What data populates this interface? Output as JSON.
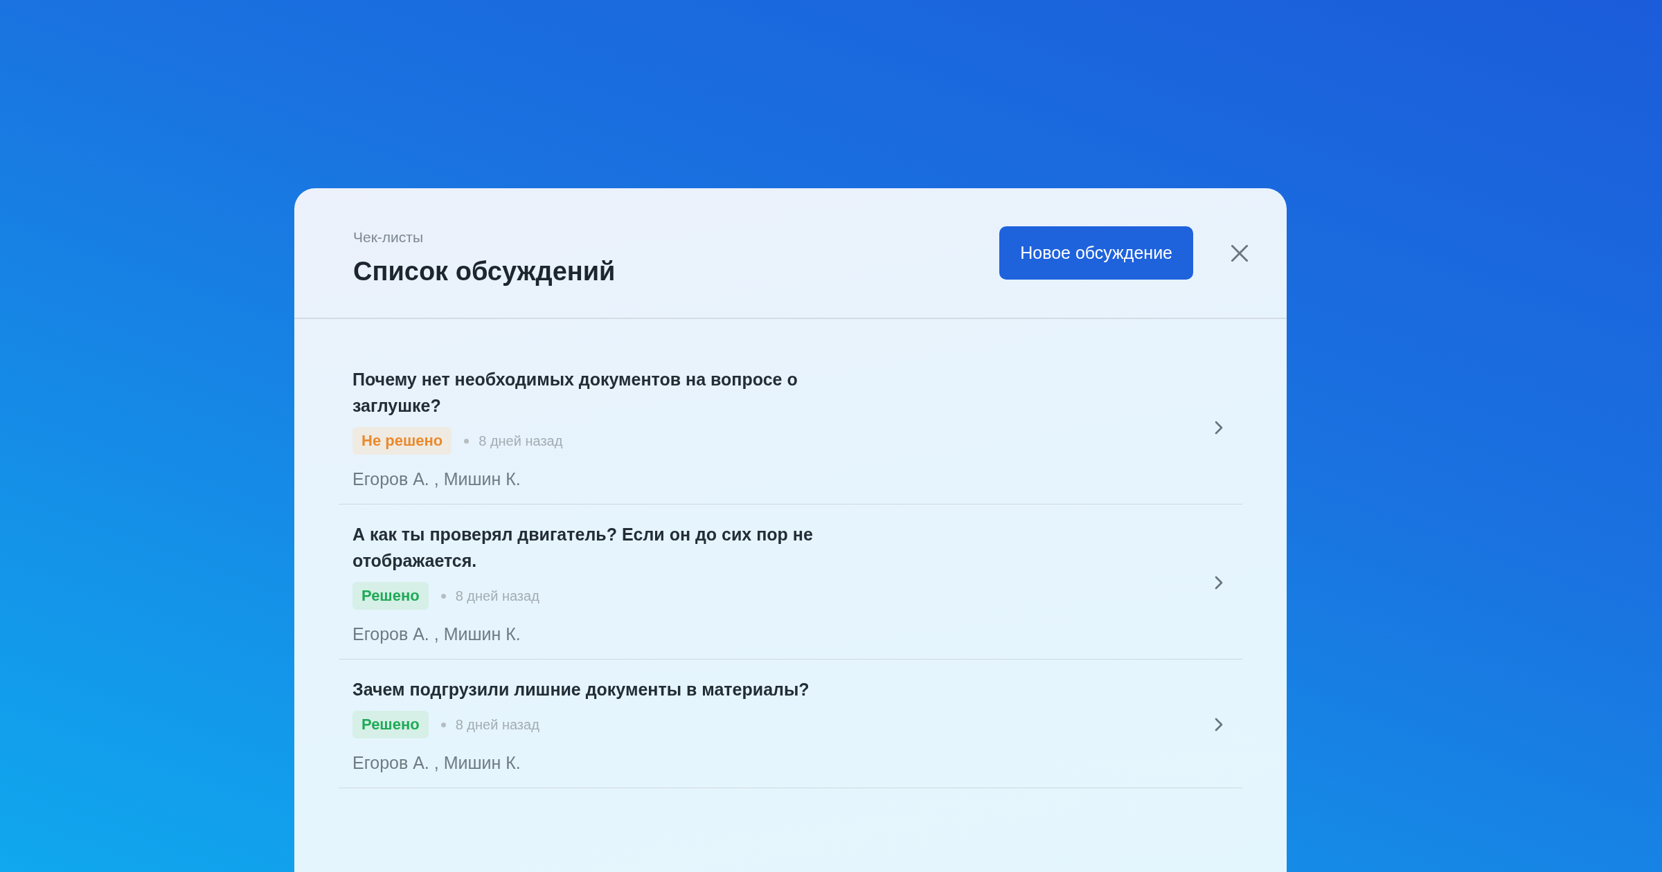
{
  "breadcrumb": "Чек-листы",
  "title": "Список обсуждений",
  "new_button": "Новое обсуждение",
  "discussions": [
    {
      "title": "Почему нет необходимых документов на вопросе о заглушке?",
      "status": "Не решено",
      "resolved": false,
      "time": "8 дней назад",
      "authors": "Егоров А. , Мишин К."
    },
    {
      "title": "А как ты проверял двигатель? Если он до сих пор не отображается.",
      "status": "Решено",
      "resolved": true,
      "time": "8 дней назад",
      "authors": "Егоров А. , Мишин К."
    },
    {
      "title": "Зачем подгрузили лишние документы в материалы?",
      "status": "Решено",
      "resolved": true,
      "time": "8 дней назад",
      "authors": "Егоров А. , Мишин К."
    }
  ]
}
